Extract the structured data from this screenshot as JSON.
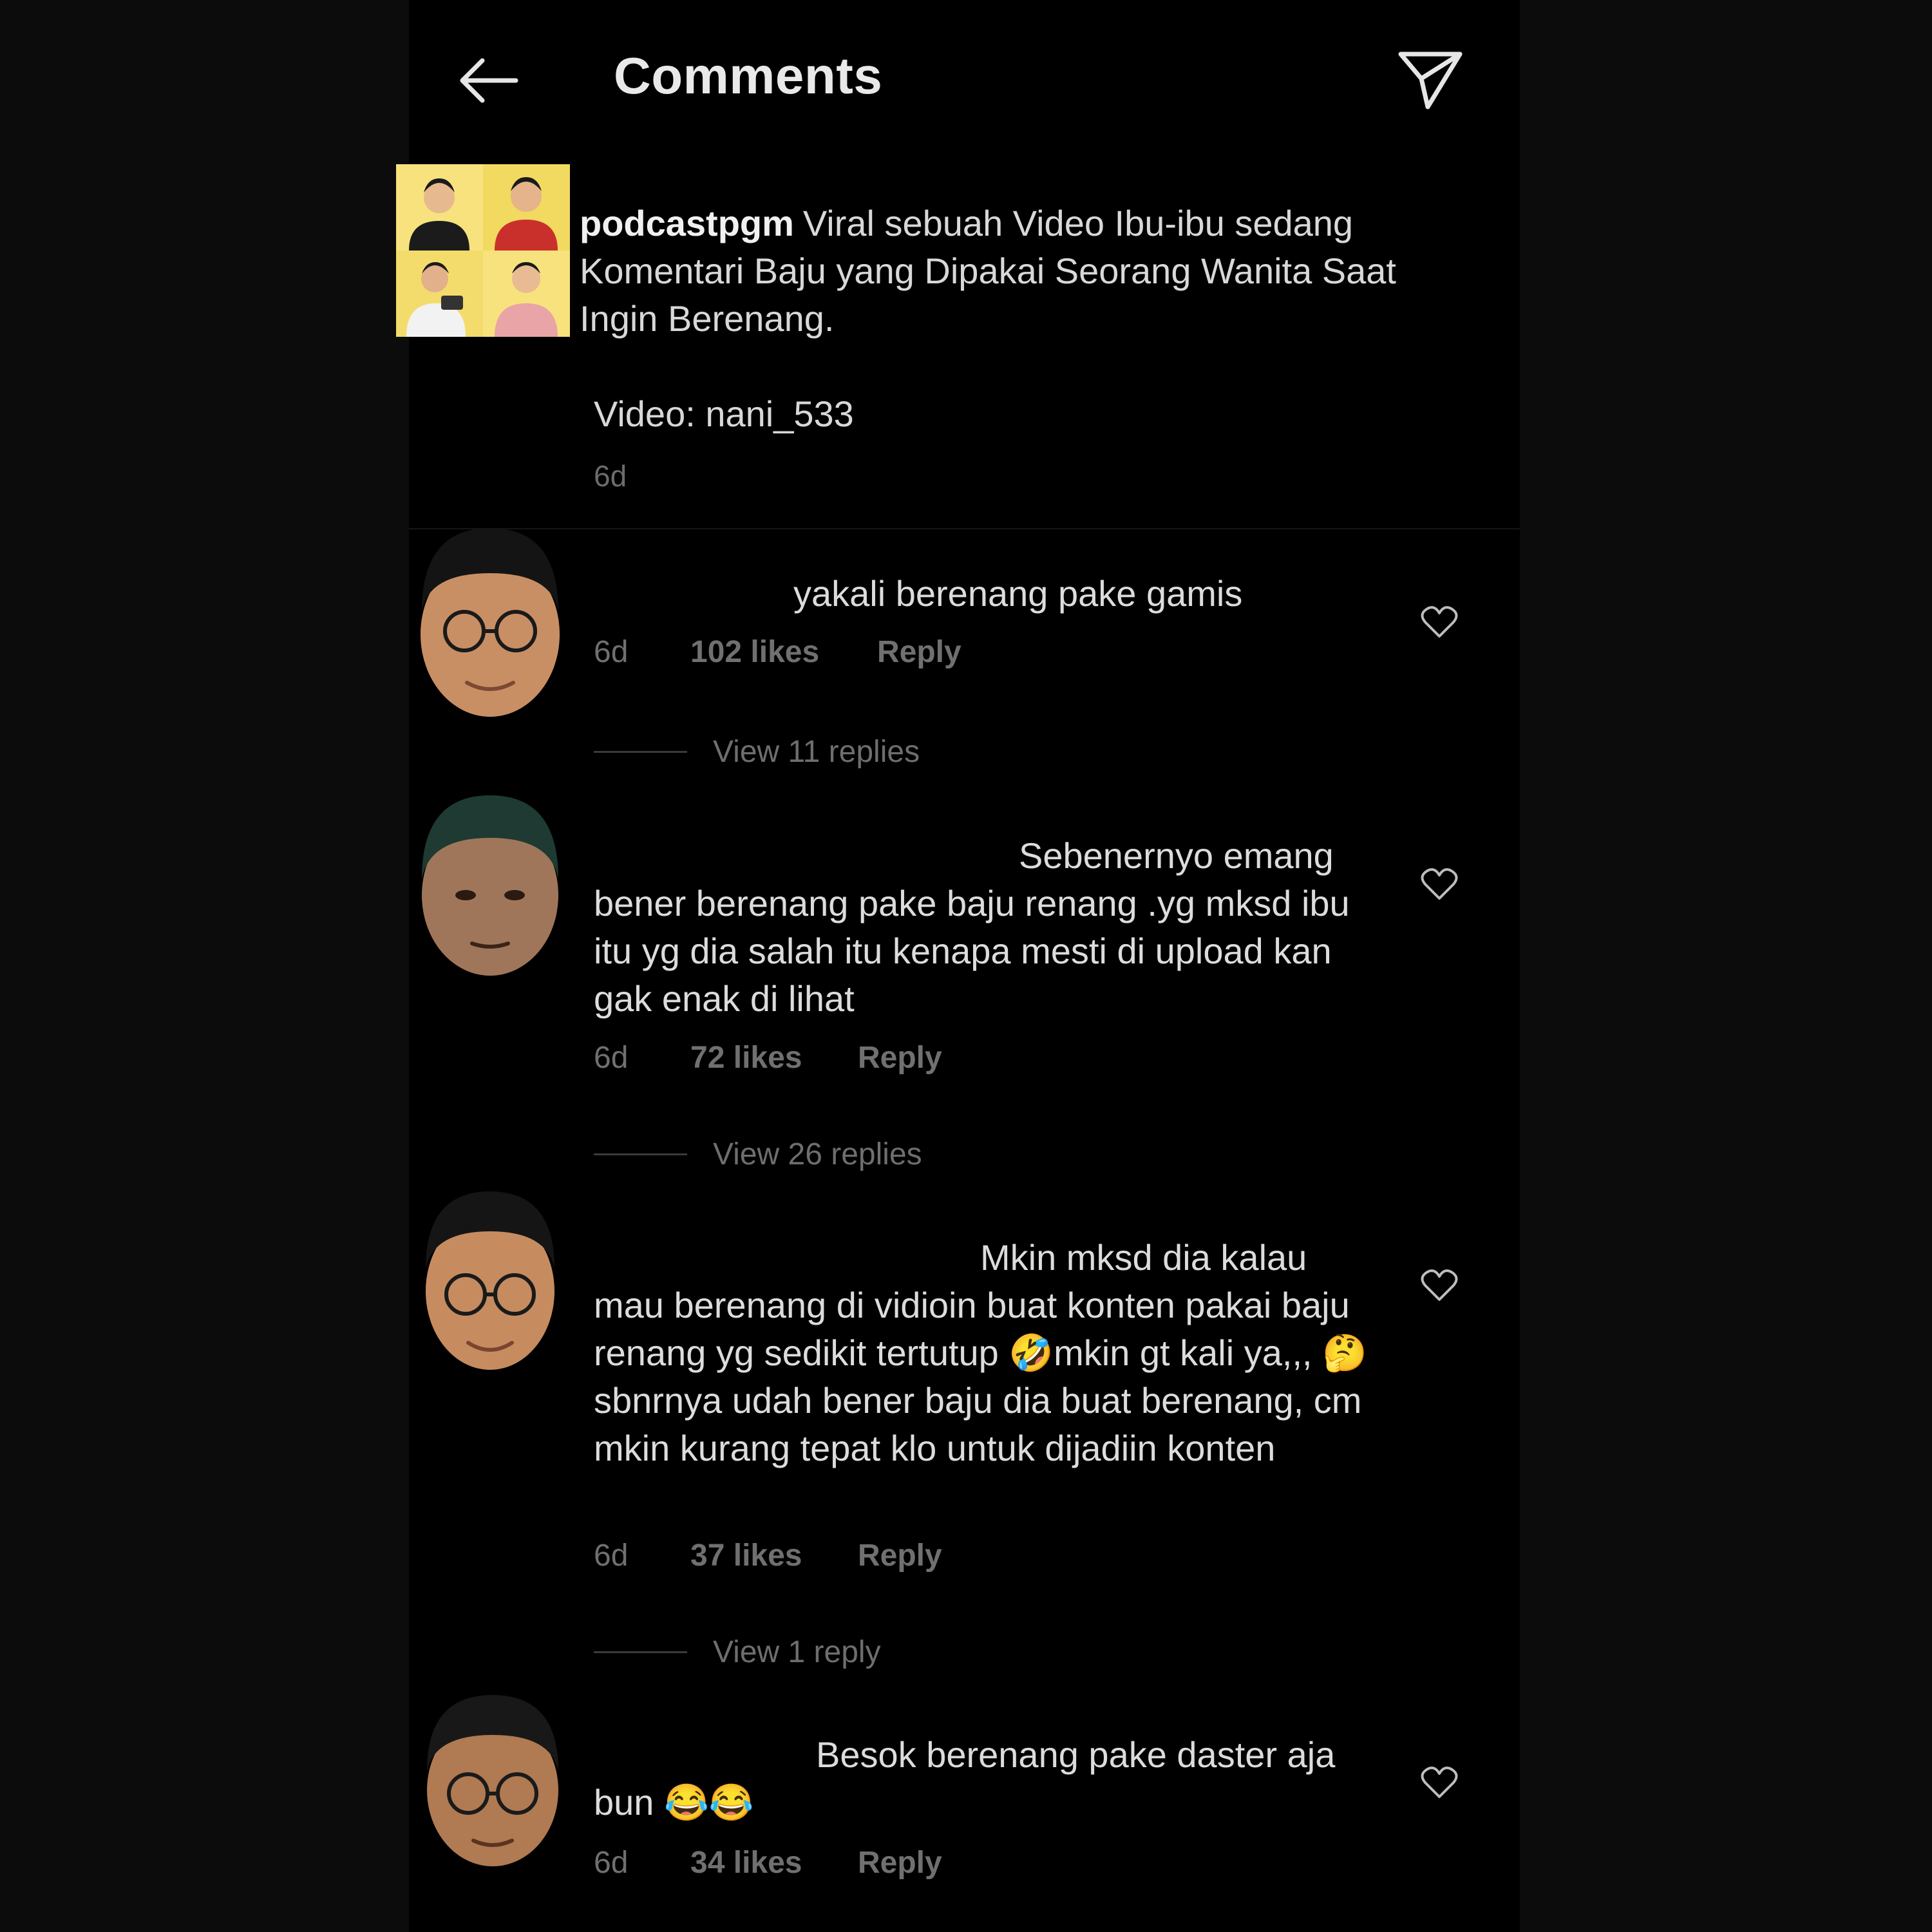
{
  "header": {
    "title": "Comments",
    "back_icon": "arrow-left-icon",
    "send_icon": "paper-plane-icon"
  },
  "post": {
    "username": "podcastpgm",
    "caption": "Viral sebuah Video Ibu-ibu sedang Komentari Baju yang Dipakai Seorang Wanita Saat Ingin Berenang.",
    "credit": "Video: nani_533",
    "time": "6d"
  },
  "comments": [
    {
      "text": "yakali berenang pake gamis",
      "time": "6d",
      "likes": "102 likes",
      "reply_label": "Reply",
      "view_replies": "View 11 replies"
    },
    {
      "text": "Sebenernyo emang bener berenang pake baju renang .yg mksd ibu itu yg dia salah itu kenapa mesti di upload kan gak enak di lihat",
      "time": "6d",
      "likes": "72 likes",
      "reply_label": "Reply",
      "view_replies": "View 26 replies"
    },
    {
      "text": "Mkin mksd dia kalau mau berenang di vidioin buat konten pakai baju renang yg sedikit tertutup 🤣mkin gt kali ya,,, 🤔 sbnrnya udah bener baju dia buat berenang, cm mkin kurang tepat klo untuk dijadiin konten",
      "time": "6d",
      "likes": "37 likes",
      "reply_label": "Reply",
      "view_replies": "View 1 reply"
    },
    {
      "text": "Besok berenang pake daster aja bun 😂😂",
      "time": "6d",
      "likes": "34 likes",
      "reply_label": "Reply"
    }
  ],
  "colors": {
    "background": "#000000",
    "text_primary": "#e6e6e6",
    "text_secondary": "#707070",
    "avatar_bg": "#f4df74"
  }
}
